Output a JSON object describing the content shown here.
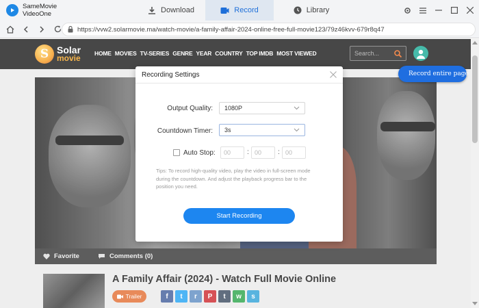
{
  "app": {
    "name_line1": "SameMovie",
    "name_line2": "VideoOne"
  },
  "tabs": [
    {
      "label": "Download",
      "active": false
    },
    {
      "label": "Record",
      "active": true
    },
    {
      "label": "Library",
      "active": false
    }
  ],
  "browser": {
    "url": "https://vvw2.solarmovie.ma/watch-movie/a-family-affair-2024-online-free-full-movie123/79z46kvv-679r8q47"
  },
  "site": {
    "logo_word1": "Solar",
    "logo_word2": "movie",
    "logo_letter": "S",
    "menu": [
      "HOME",
      "MOVIES",
      "TV-SERIES",
      "GENRE",
      "YEAR",
      "COUNTRY",
      "TOP IMDB",
      "MOST VIEWED"
    ],
    "search_placeholder": "Search...",
    "actions": {
      "favorite": "Favorite",
      "comments": "Comments (0)"
    },
    "movie_title": "A Family Affair (2024) - Watch Full Movie Online",
    "trailer_label": "Trailer",
    "share": [
      "f",
      "t",
      "r",
      "P",
      "t",
      "w",
      "s"
    ]
  },
  "record_entire_label": "Record entire page",
  "dialog": {
    "title": "Recording Settings",
    "output_quality_label": "Output Quality:",
    "output_quality_value": "1080P",
    "countdown_label": "Countdown Timer:",
    "countdown_value": "3s",
    "auto_stop_label": "Auto Stop:",
    "auto_stop": {
      "hours": "00",
      "minutes": "00",
      "seconds": "00"
    },
    "auto_stop_checked": false,
    "tips": "Tips: To record high-quality video, play the video in full-screen mode during the countdown. And adjust the playback progress bar to the position you need.",
    "start_button": "Start Recording"
  },
  "colors": {
    "accent": "#1d86f0",
    "active_tab": "#1e6fd9",
    "trailer": "#e26a2c",
    "avatar": "#12a892"
  }
}
